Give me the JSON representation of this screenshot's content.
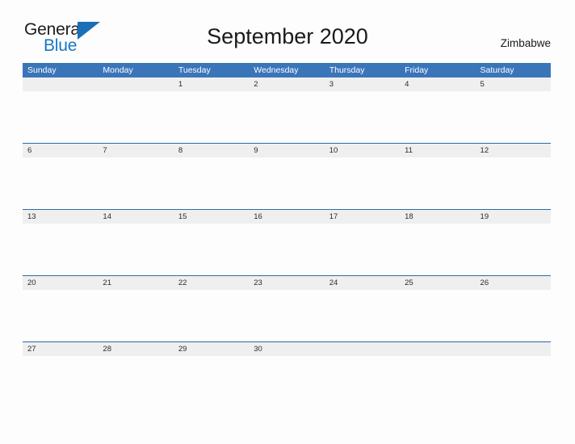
{
  "header": {
    "brand_general": "General",
    "brand_blue": "Blue",
    "brand_flag_icon": "flag-triangle-icon",
    "title": "September 2020",
    "location": "Zimbabwe"
  },
  "colors": {
    "header_blue": "#3a75ba",
    "week_divider_blue": "#2b6ca8",
    "date_band_gray": "#efefef",
    "brand_blue": "#1877c4",
    "page_background": "#fdfdfd"
  },
  "calendar": {
    "month": "September",
    "year": "2020",
    "day_headers": [
      "Sunday",
      "Monday",
      "Tuesday",
      "Wednesday",
      "Thursday",
      "Friday",
      "Saturday"
    ],
    "weeks": [
      [
        "",
        "",
        "1",
        "2",
        "3",
        "4",
        "5"
      ],
      [
        "6",
        "7",
        "8",
        "9",
        "10",
        "11",
        "12"
      ],
      [
        "13",
        "14",
        "15",
        "16",
        "17",
        "18",
        "19"
      ],
      [
        "20",
        "21",
        "22",
        "23",
        "24",
        "25",
        "26"
      ],
      [
        "27",
        "28",
        "29",
        "30",
        "",
        "",
        ""
      ]
    ]
  }
}
